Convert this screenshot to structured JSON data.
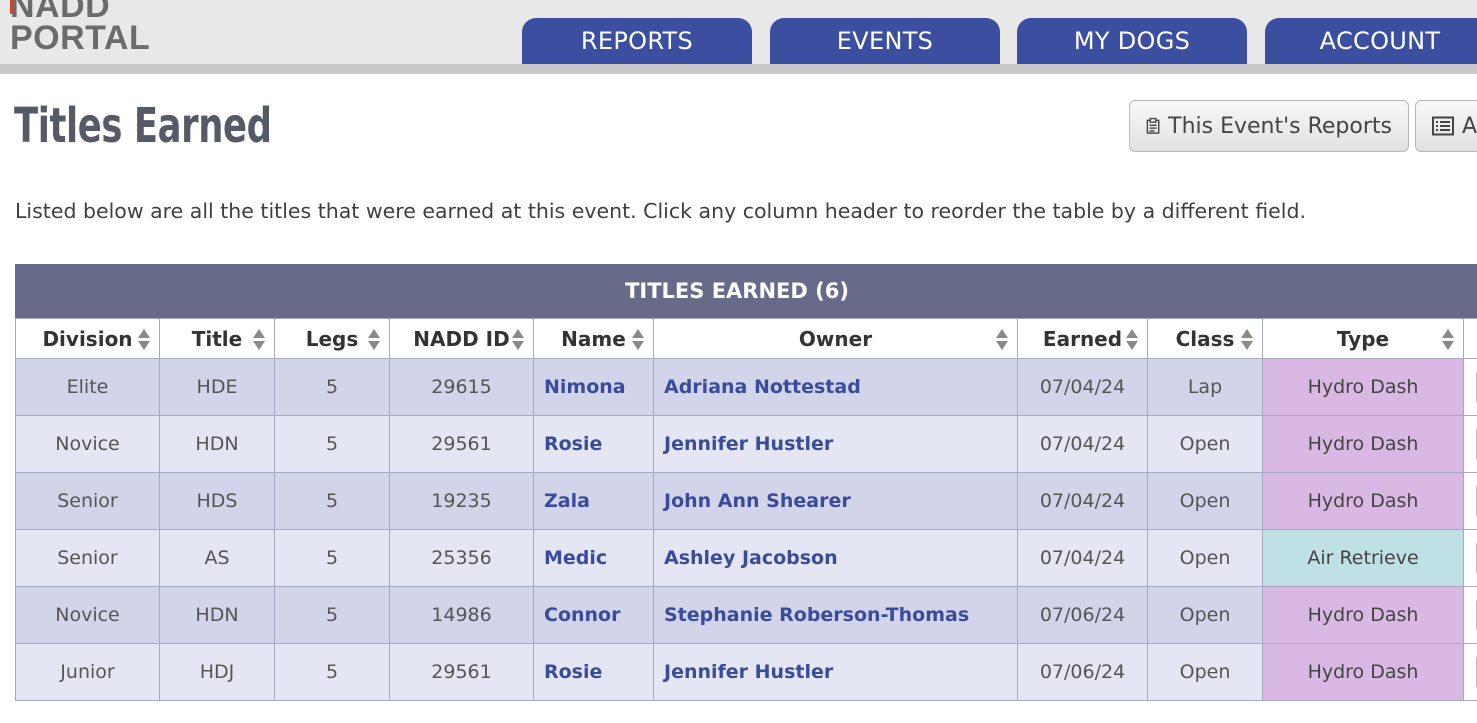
{
  "logo": {
    "line1": "NADD",
    "line2": "PORTAL"
  },
  "nav": {
    "tabs": [
      {
        "label": "REPORTS"
      },
      {
        "label": "EVENTS"
      },
      {
        "label": "MY DOGS"
      },
      {
        "label": "ACCOUNT"
      }
    ]
  },
  "page": {
    "title": "Titles Earned",
    "intro": "Listed below are all the titles that were earned at this event. Click any column header to reorder the table by a different field."
  },
  "actions": {
    "event_reports_label": "This Event's Reports",
    "second_label": "A"
  },
  "table": {
    "caption": "TITLES EARNED (6)",
    "headers": [
      "Division",
      "Title",
      "Legs",
      "NADD ID",
      "Name",
      "Owner",
      "Earned",
      "Class",
      "Type"
    ],
    "rows": [
      {
        "division": "Elite",
        "title": "HDE",
        "legs": "5",
        "nadd_id": "29615",
        "name": "Nimona",
        "owner": "Adriana Nottestad",
        "earned": "07/04/24",
        "class": "Lap",
        "type": "Hydro Dash"
      },
      {
        "division": "Novice",
        "title": "HDN",
        "legs": "5",
        "nadd_id": "29561",
        "name": "Rosie",
        "owner": "Jennifer Hustler",
        "earned": "07/04/24",
        "class": "Open",
        "type": "Hydro Dash"
      },
      {
        "division": "Senior",
        "title": "HDS",
        "legs": "5",
        "nadd_id": "19235",
        "name": "Zala",
        "owner": "John Ann Shearer",
        "earned": "07/04/24",
        "class": "Open",
        "type": "Hydro Dash"
      },
      {
        "division": "Senior",
        "title": "AS",
        "legs": "5",
        "nadd_id": "25356",
        "name": "Medic",
        "owner": "Ashley Jacobson",
        "earned": "07/04/24",
        "class": "Open",
        "type": "Air Retrieve"
      },
      {
        "division": "Novice",
        "title": "HDN",
        "legs": "5",
        "nadd_id": "14986",
        "name": "Connor",
        "owner": "Stephanie Roberson-Thomas",
        "earned": "07/06/24",
        "class": "Open",
        "type": "Hydro Dash"
      },
      {
        "division": "Junior",
        "title": "HDJ",
        "legs": "5",
        "nadd_id": "29561",
        "name": "Rosie",
        "owner": "Jennifer Hustler",
        "earned": "07/06/24",
        "class": "Open",
        "type": "Hydro Dash"
      }
    ]
  },
  "colors": {
    "nav_tab": "#3b4ea0",
    "caption_bg": "#676b8a",
    "row_odd": "#d2d5ea",
    "row_even": "#e4e6f3",
    "hydro_dash": "#d9b9e4",
    "air_retrieve": "#bfe0e4",
    "link": "#3b4b9c"
  },
  "icons": {
    "event_reports": "clipboard-icon",
    "second_button": "list-icon",
    "sort": "sort-icon"
  }
}
